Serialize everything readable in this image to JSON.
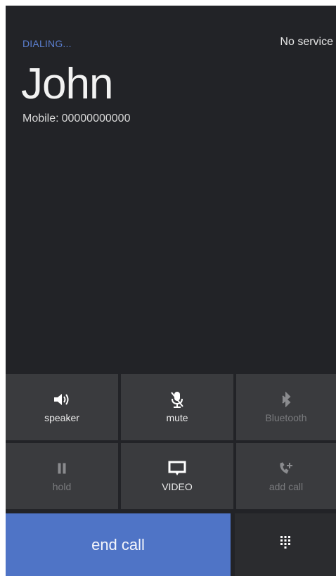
{
  "call": {
    "status": "DIALING...",
    "service": "No service",
    "caller_name": "John",
    "number_label": "Mobile:",
    "number_value": "00000000000"
  },
  "controls": {
    "speaker": "speaker",
    "mute": "mute",
    "bluetooth": "Bluetooth",
    "hold": "hold",
    "video": "VIDEO",
    "add_call": "add call",
    "end_call": "end call"
  },
  "icons": {
    "speaker": "speaker-icon",
    "mute": "microphone-muted-icon",
    "bluetooth": "bluetooth-icon",
    "hold": "pause-icon",
    "video": "video-screen-icon",
    "add_call": "add-call-icon",
    "keypad": "keypad-icon"
  },
  "colors": {
    "background": "#222327",
    "tile": "#3a3b3e",
    "accent": "#4f74c6",
    "status_text": "#5b7fd0"
  }
}
